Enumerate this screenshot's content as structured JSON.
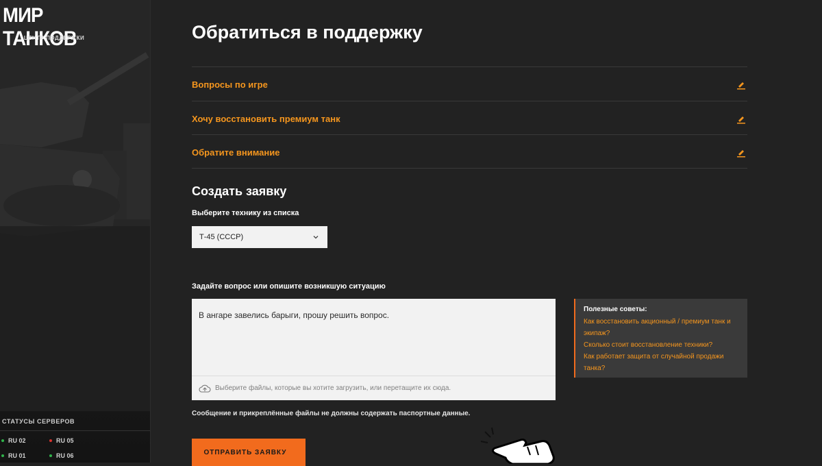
{
  "sidebar": {
    "logo": "МИР ТАНКОВ",
    "subtitle": "ЦЕНТР ПОДДЕРЖКИ",
    "status_title": "СТАТУСЫ СЕРВЕРОВ",
    "servers": [
      {
        "label": "RU 02",
        "status": "online",
        "color": "#2fb34a"
      },
      {
        "label": "RU 05",
        "status": "offline",
        "color": "#d8322d"
      },
      {
        "label": "RU 01",
        "status": "online",
        "color": "#2fb34a"
      },
      {
        "label": "RU 06",
        "status": "online",
        "color": "#2fb34a"
      }
    ]
  },
  "main": {
    "title": "Обратиться в поддержку",
    "accordion": [
      {
        "label": "Вопросы по игре",
        "icon": "pencil-icon"
      },
      {
        "label": "Хочу восстановить премиум танк",
        "icon": "pencil-icon"
      },
      {
        "label": "Обратите внимание",
        "icon": "pencil-icon"
      }
    ],
    "form": {
      "section_title": "Создать заявку",
      "vehicle_label": "Выберите технику из списка",
      "vehicle_selected": "Т-45 (СССР)",
      "question_label": "Задайте вопрос или опишите возникшую ситуацию",
      "question_value": "В ангаре завелись барыги, прошу решить вопрос.",
      "upload_text": "Выберите файлы, которые вы хотите загрузить, или перетащите их сюда.",
      "note": "Сообщение и прикреплённые файлы не должны содержать паспортные данные.",
      "submit_label": "ОТПРАВИТЬ ЗАЯВКУ"
    },
    "tips": {
      "title": "Полезные советы:",
      "links": [
        "Как восстановить акционный / премиум танк и экипаж?",
        "Сколько стоит восстановление техники?",
        "Как работает защита от случайной продажи танка?"
      ]
    }
  },
  "colors": {
    "accent": "#f5961e",
    "button": "#f26b1d",
    "background": "#222222"
  }
}
